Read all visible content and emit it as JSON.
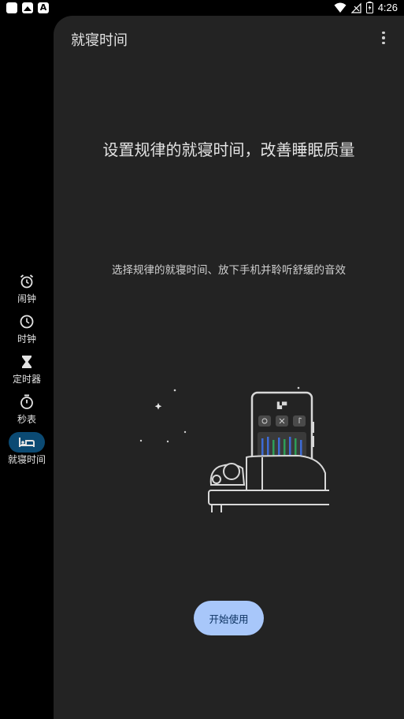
{
  "status_bar": {
    "time": "4:26",
    "icons": [
      "notification-icon",
      "image-icon",
      "font-icon",
      "wifi-icon",
      "signal-icon",
      "battery-icon"
    ]
  },
  "nav_rail": {
    "items": [
      {
        "label": "闹钟",
        "icon": "alarm-icon",
        "active": false
      },
      {
        "label": "时钟",
        "icon": "clock-icon",
        "active": false
      },
      {
        "label": "定时器",
        "icon": "hourglass-icon",
        "active": false
      },
      {
        "label": "秒表",
        "icon": "stopwatch-icon",
        "active": false
      },
      {
        "label": "就寝时间",
        "icon": "bed-icon",
        "active": true
      }
    ],
    "active_color": "#0b4a73"
  },
  "main": {
    "title": "就寝时间",
    "headline": "设置规律的就寝时间，改善睡眠质量",
    "subtext": "选择规律的就寝时间、放下手机并聆听舒缓的音效",
    "start_button": "开始使用",
    "accent_color": "#a8c7fa",
    "background_color": "#232323"
  }
}
